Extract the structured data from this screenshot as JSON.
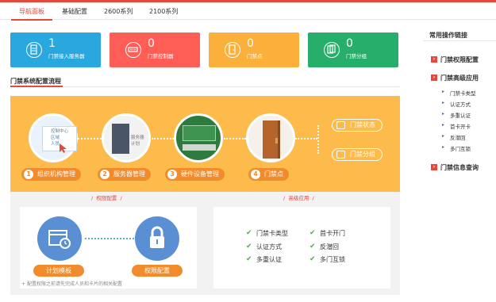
{
  "nav": {
    "tabs": [
      "导航面板",
      "基础配置",
      "2600系列",
      "2100系列"
    ],
    "active": 0
  },
  "cards": [
    {
      "value": "1",
      "label": "门禁接入服务器",
      "color": "#29a8df",
      "icon": "server-icon"
    },
    {
      "value": "0",
      "label": "门禁控制器",
      "color": "#ff5e57",
      "icon": "controller-icon"
    },
    {
      "value": "0",
      "label": "门禁点",
      "color": "#fbb03b",
      "icon": "door-icon"
    },
    {
      "value": "0",
      "label": "门禁分组",
      "color": "#27ae6b",
      "icon": "group-icon"
    }
  ],
  "section_title": "门禁系统配置流程",
  "flow": {
    "steps": [
      {
        "num": "1",
        "label": "组织机构管理"
      },
      {
        "num": "2",
        "label": "服务器管理"
      },
      {
        "num": "3",
        "label": "硬件设备管理"
      },
      {
        "num": "4",
        "label": "门禁点"
      }
    ],
    "org_screen": [
      "控制中心",
      "区域",
      "人员"
    ],
    "server_screen": [
      "服务器",
      "计划"
    ],
    "options": [
      "门禁状态",
      "门禁分组"
    ]
  },
  "permission": {
    "title": "权限配置",
    "buttons": [
      "计划模板",
      "权限配置"
    ],
    "note": "配置权限之前请先完成人员和卡片的相关配置"
  },
  "advanced": {
    "title": "高级应用",
    "items": [
      "门禁卡类型",
      "首卡开门",
      "认证方式",
      "反潜回",
      "多重认证",
      "多门互锁"
    ]
  },
  "sidebar": {
    "title": "常用操作链接",
    "permission_config": "门禁权限配置",
    "advanced_app": "门禁高级应用",
    "advanced_sub": [
      "门禁卡类型",
      "认证方式",
      "多重认证",
      "首卡开卡",
      "反潜回",
      "多门互锁"
    ],
    "info_query": "门禁信息查询"
  },
  "colors": {
    "accent": "#e34a3c",
    "flow_bg": "#fcbb4a",
    "step_pill": "#f28b2c",
    "plan_circle": "#5b8fd4",
    "lock_circle": "#5b8fd4"
  }
}
